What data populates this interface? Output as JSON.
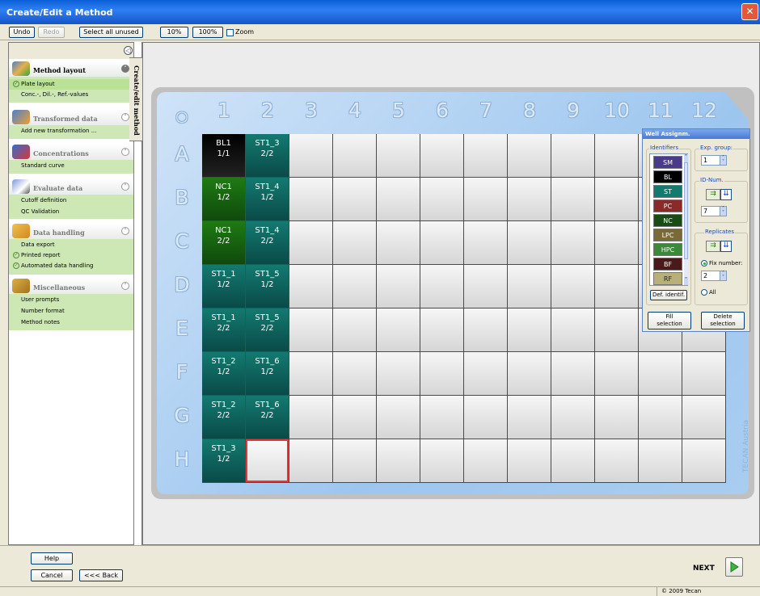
{
  "window": {
    "title": "Create/Edit a Method",
    "close_glyph": "✕"
  },
  "toolbar": {
    "undo": "Undo",
    "redo": "Redo",
    "select_unused": "Select all unused",
    "zoom10": "10%",
    "zoom100": "100%",
    "zoom_label": "Zoom"
  },
  "sidebar": {
    "collapse_glyph": "◁",
    "vertical_tab": "Create/edit method",
    "sections": [
      {
        "title": "Method layout",
        "items": [
          "Plate layout",
          "Conc.-, Dil.-, Ref.-values"
        ]
      },
      {
        "title": "Transformed data",
        "items": [
          "Add new transformation ..."
        ]
      },
      {
        "title": "Concentrations",
        "items": [
          "Standard curve"
        ]
      },
      {
        "title": "Evaluate data",
        "items": [
          "Cutoff definition",
          "QC Validation"
        ]
      },
      {
        "title": "Data handling",
        "items": [
          "Data export",
          "Printed report",
          "Automated data handling"
        ]
      },
      {
        "title": "Miscellaneous",
        "items": [
          "User prompts",
          "Number format",
          "Method notes"
        ]
      }
    ]
  },
  "plate": {
    "corner": "○",
    "columns": [
      "1",
      "2",
      "3",
      "4",
      "5",
      "6",
      "7",
      "8",
      "9",
      "10",
      "11",
      "12"
    ],
    "rows": [
      "A",
      "B",
      "C",
      "D",
      "E",
      "F",
      "G",
      "H"
    ],
    "brand": "TECAN Austria",
    "wells": [
      {
        "id": "A1",
        "name": "BL1",
        "rep": "1/1",
        "type": "BL"
      },
      {
        "id": "B1",
        "name": "NC1",
        "rep": "1/2",
        "type": "NC"
      },
      {
        "id": "C1",
        "name": "NC1",
        "rep": "2/2",
        "type": "NC"
      },
      {
        "id": "D1",
        "name": "ST1_1",
        "rep": "1/2",
        "type": "ST"
      },
      {
        "id": "E1",
        "name": "ST1_1",
        "rep": "2/2",
        "type": "ST"
      },
      {
        "id": "F1",
        "name": "ST1_2",
        "rep": "1/2",
        "type": "ST"
      },
      {
        "id": "G1",
        "name": "ST1_2",
        "rep": "2/2",
        "type": "ST"
      },
      {
        "id": "H1",
        "name": "ST1_3",
        "rep": "1/2",
        "type": "ST"
      },
      {
        "id": "A2",
        "name": "ST1_3",
        "rep": "2/2",
        "type": "ST"
      },
      {
        "id": "B2",
        "name": "ST1_4",
        "rep": "1/2",
        "type": "ST"
      },
      {
        "id": "C2",
        "name": "ST1_4",
        "rep": "2/2",
        "type": "ST"
      },
      {
        "id": "D2",
        "name": "ST1_5",
        "rep": "1/2",
        "type": "ST"
      },
      {
        "id": "E2",
        "name": "ST1_5",
        "rep": "2/2",
        "type": "ST"
      },
      {
        "id": "F2",
        "name": "ST1_6",
        "rep": "1/2",
        "type": "ST"
      },
      {
        "id": "G2",
        "name": "ST1_6",
        "rep": "2/2",
        "type": "ST"
      },
      {
        "id": "H2",
        "name": "",
        "rep": "",
        "type": "selected"
      }
    ]
  },
  "well_assign": {
    "title": "Well Assignm.",
    "identifiers_label": "Identifiers",
    "identifiers": [
      {
        "code": "SM",
        "color": "#4a3a8a"
      },
      {
        "code": "BL",
        "color": "#000000"
      },
      {
        "code": "ST",
        "color": "#137a70"
      },
      {
        "code": "PC",
        "color": "#8a2a2a"
      },
      {
        "code": "NC",
        "color": "#1a4a16"
      },
      {
        "code": "LPC",
        "color": "#7a6a3a"
      },
      {
        "code": "HPC",
        "color": "#3a8a3a"
      },
      {
        "code": "BF",
        "color": "#4a1a1a"
      },
      {
        "code": "RF",
        "color": "#b8b078"
      }
    ],
    "def_identif": "Def. identif.",
    "exp_group_label": "Exp. group:",
    "exp_group_value": "1",
    "id_num_label": "ID-Num.",
    "id_num_value": "7",
    "replicates_label": "Replicates",
    "fix_number_label": "Fix number:",
    "fix_number_value": "2",
    "all_label": "All",
    "fill_selection": "Fill\nselection",
    "delete_selection": "Delete\nselection"
  },
  "bottom": {
    "help": "Help",
    "cancel": "Cancel",
    "back": "<<< Back",
    "next": "NEXT"
  },
  "status": {
    "copyright": "© 2009 Tecan"
  }
}
